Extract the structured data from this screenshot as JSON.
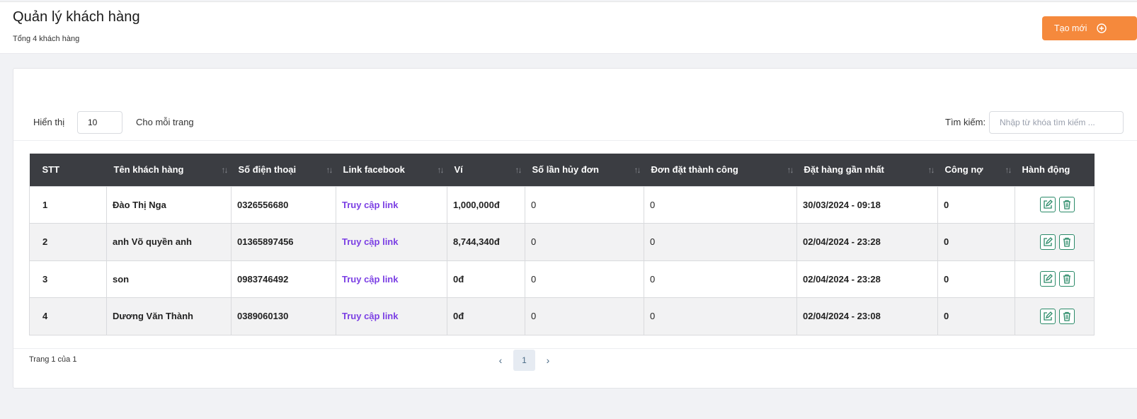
{
  "header": {
    "title": "Quản lý khách hàng",
    "subtitle": "Tổng 4 khách hàng",
    "create_label": "Tạo mới"
  },
  "toolbar": {
    "show_label": "Hiển thị",
    "page_size": "10",
    "per_page_label": "Cho mỗi trang",
    "search_label": "Tìm kiếm:",
    "search_placeholder": "Nhập từ khóa tìm kiếm ..."
  },
  "table": {
    "headers": [
      "STT",
      "Tên khách hàng",
      "Số điện thoại",
      "Link facebook",
      "Ví",
      "Số lần hủy đơn",
      "Đơn đặt thành công",
      "Đặt hàng gần nhất",
      "Công nợ",
      "Hành động"
    ],
    "rows": [
      {
        "stt": "1",
        "name": "Đào Thị Nga",
        "phone": "0326556680",
        "facebook": "Truy cập link",
        "wallet": "1,000,000đ",
        "cancelled": "0",
        "success": "0",
        "last_order": "30/03/2024 - 09:18",
        "debt": "0"
      },
      {
        "stt": "2",
        "name": "anh Võ quyền anh",
        "phone": "01365897456",
        "facebook": "Truy cập link",
        "wallet": "8,744,340đ",
        "cancelled": "0",
        "success": "0",
        "last_order": "02/04/2024 - 23:28",
        "debt": "0"
      },
      {
        "stt": "3",
        "name": "son",
        "phone": "0983746492",
        "facebook": "Truy cập link",
        "wallet": "0đ",
        "cancelled": "0",
        "success": "0",
        "last_order": "02/04/2024 - 23:28",
        "debt": "0"
      },
      {
        "stt": "4",
        "name": "Dương Văn Thành",
        "phone": "0389060130",
        "facebook": "Truy cập link",
        "wallet": "0đ",
        "cancelled": "0",
        "success": "0",
        "last_order": "02/04/2024 - 23:08",
        "debt": "0"
      }
    ]
  },
  "pagination": {
    "info": "Trang 1 của 1",
    "prev": "‹",
    "current": "1",
    "next": "›"
  },
  "colors": {
    "accent": "#f5893c",
    "header_bg": "#3b3d42",
    "link": "#7b3fe4",
    "cancelled": "#f0a21c",
    "success": "#e0443a",
    "action": "#2a8a68"
  },
  "icons": {
    "create": "plus-circle-icon",
    "sort": "sort-arrows-icon",
    "edit": "edit-icon",
    "delete": "trash-icon"
  }
}
